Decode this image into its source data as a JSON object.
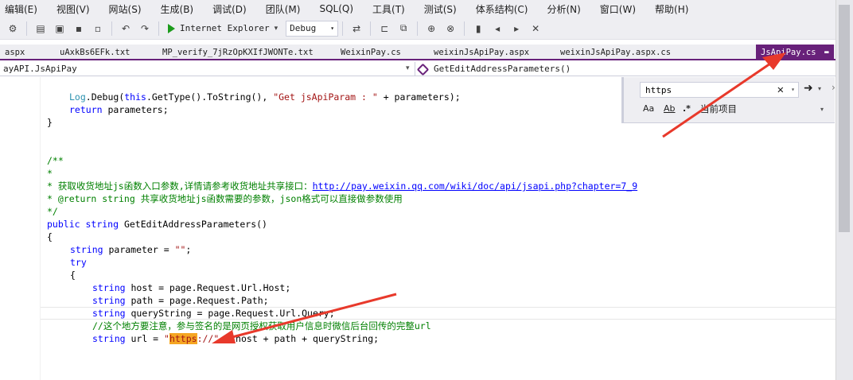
{
  "menu": [
    "编辑(E)",
    "视图(V)",
    "网站(S)",
    "生成(B)",
    "调试(D)",
    "团队(M)",
    "SQL(Q)",
    "工具(T)",
    "测试(S)",
    "体系结构(C)",
    "分析(N)",
    "窗口(W)",
    "帮助(H)"
  ],
  "toolbar": {
    "run_target": "Internet Explorer",
    "configuration": "Debug"
  },
  "tabs": [
    {
      "label": "aspx",
      "active": false
    },
    {
      "label": "uAxkBs6EFk.txt",
      "active": false
    },
    {
      "label": "MP_verify_7jRzOpKXIfJWONTe.txt",
      "active": false
    },
    {
      "label": "WeixinPay.cs",
      "active": false
    },
    {
      "label": "weixinJsApiPay.aspx",
      "active": false
    },
    {
      "label": "weixinJsApiPay.aspx.cs",
      "active": false
    },
    {
      "label": "JsApiPay.cs",
      "active": true
    }
  ],
  "navbar": {
    "type_path": "ayAPI.JsApiPay",
    "member": "GetEditAddressParameters()"
  },
  "find": {
    "query": "https",
    "opt_case": "Aa",
    "opt_word": "Ab",
    "opt_regex": ".*",
    "scope": "当前项目"
  },
  "code": {
    "l1_log": "Log",
    "l1_debug": ".Debug(",
    "l1_this": "this",
    "l1_rest": ".GetType().ToString(), ",
    "l1_str": "\"Get jsApiParam : \"",
    "l1_tail": " + parameters);",
    "l2_return": "return",
    "l2_rest": " parameters;",
    "l3": "}",
    "c1": "/**",
    "c2": "*",
    "c3_pre": "* 获取收货地址js函数入口参数,详情请参考收货地址共享接口：",
    "c3_link": "http://pay.weixin.qq.com/wiki/doc/api/jsapi.php?chapter=7_9",
    "c4": "* @return string 共享收货地址js函数需要的参数，json格式可以直接做参数使用",
    "c5": "*/",
    "sig_public": "public",
    "sig_string": "string",
    "sig_name": " GetEditAddressParameters()",
    "brace_open": "{",
    "p_string": "string",
    "p_rest": " parameter = ",
    "p_str": "\"\"",
    "p_end": ";",
    "try_kw": "try",
    "brace_open2": "{",
    "h_string": "string",
    "h_rest": " host = page.Request.Url.Host;",
    "pa_string": "string",
    "pa_rest": " path = page.Request.Path;",
    "q_string": "string",
    "q_rest": " queryString = page.Request.Url.Query;",
    "note": "//这个地方要注意，参与签名的是网页授权获取用户信息时微信后台回传的完整url",
    "u_string": "string",
    "u_mid": " url = ",
    "u_q1": "\"",
    "u_https": "https",
    "u_rest_str": "://\"",
    "u_tail": " + host + path + queryString;"
  }
}
